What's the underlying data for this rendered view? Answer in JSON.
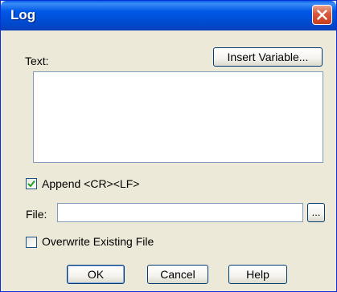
{
  "window": {
    "title": "Log"
  },
  "text_section": {
    "label": "Text:",
    "insert_variable_button": "Insert Variable...",
    "value": ""
  },
  "append_crlf": {
    "label": "Append <CR><LF>",
    "checked": true
  },
  "file": {
    "label": "File:",
    "value": "",
    "browse_button": "..."
  },
  "overwrite": {
    "label": "Overwrite Existing File",
    "checked": false
  },
  "buttons": {
    "ok": "OK",
    "cancel": "Cancel",
    "help": "Help"
  }
}
